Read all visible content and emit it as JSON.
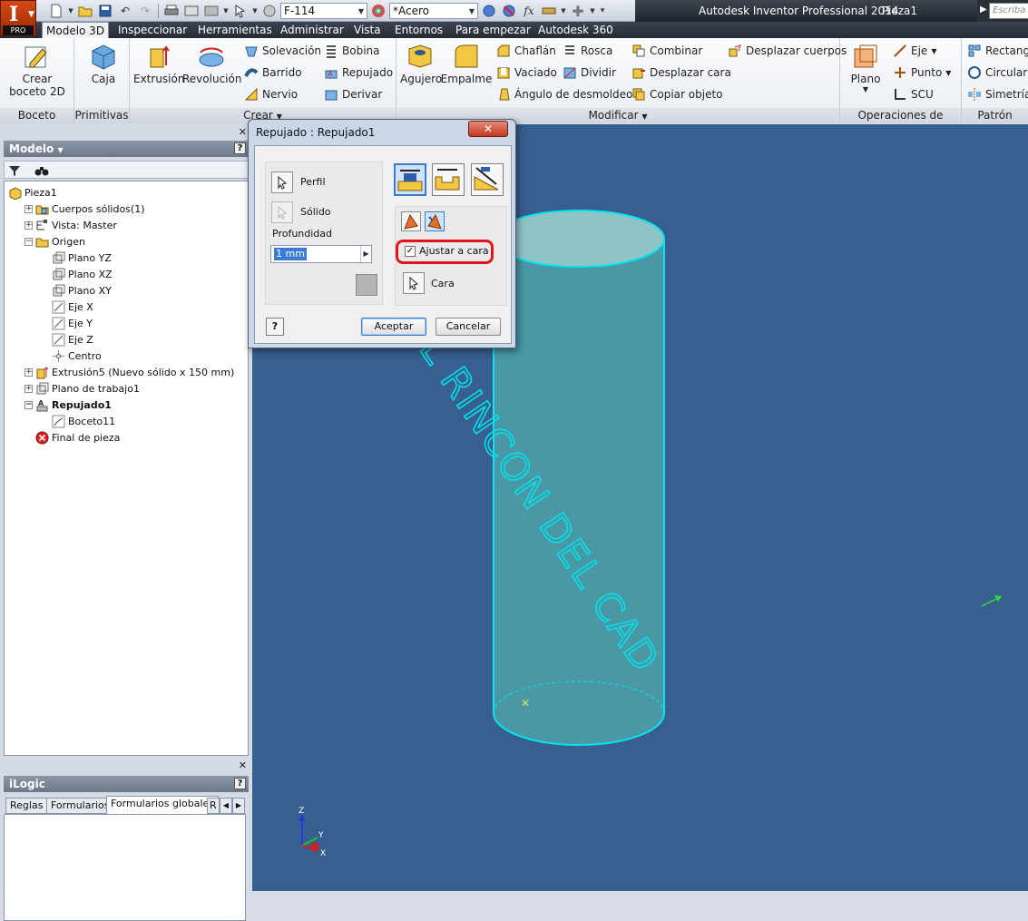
{
  "app": {
    "title": "Autodesk Inventor Professional 2014",
    "document": "Pieza1",
    "logo_letter": "I",
    "logo_edition": "PRO",
    "search_placeholder": "Escriba p"
  },
  "quick_access": {
    "style_value": "F-114",
    "material_value": "*Acero",
    "fx_label": "fx"
  },
  "tabs": [
    "Modelo 3D",
    "Inspeccionar",
    "Herramientas",
    "Administrar",
    "Vista",
    "Entornos",
    "Para empezar",
    "Autodesk 360"
  ],
  "ribbon": {
    "boceto": {
      "label": "Boceto",
      "create_line1": "Crear",
      "create_line2": "boceto 2D"
    },
    "primitivas": {
      "label": "Primitivas",
      "caja": "Caja"
    },
    "crear": {
      "label": "Crear",
      "extrusion": "Extrusión",
      "revolucion": "Revolución",
      "solevacion": "Solevación",
      "barrido": "Barrido",
      "nervio": "Nervio",
      "bobina": "Bobina",
      "repujado": "Repujado",
      "derivar": "Derivar"
    },
    "modificar": {
      "label": "Modificar",
      "agujero": "Agujero",
      "empalme": "Empalme",
      "chaflan": "Chaflán",
      "vaciado": "Vaciado",
      "angulo": "Ángulo de desmoldeo",
      "rosca": "Rosca",
      "dividir": "Dividir",
      "combinar": "Combinar",
      "desplazar_cara": "Desplazar cara",
      "copiar_objeto": "Copiar objeto",
      "desplazar_cuerpos": "Desplazar cuerpos"
    },
    "operaciones": {
      "label": "Operaciones de trabajo",
      "plano": "Plano",
      "eje": "Eje",
      "punto": "Punto",
      "scu": "SCU"
    },
    "patron": {
      "label": "Patrón",
      "rectangular": "Rectangu",
      "circular": "Circular",
      "simetria": "Simetría"
    }
  },
  "browser": {
    "title": "Modelo",
    "tree": [
      {
        "label": "Pieza1",
        "level": 0,
        "expander": "",
        "icon": "part-icon",
        "bold": false
      },
      {
        "label": "Cuerpos sólidos(1)",
        "level": 1,
        "expander": "+",
        "icon": "solid-bodies-icon",
        "bold": false
      },
      {
        "label": "Vista: Master",
        "level": 1,
        "expander": "+",
        "icon": "view-icon",
        "bold": false
      },
      {
        "label": "Origen",
        "level": 1,
        "expander": "−",
        "icon": "folder-icon",
        "bold": false
      },
      {
        "label": "Plano YZ",
        "level": 2,
        "expander": "",
        "icon": "plane-icon",
        "bold": false
      },
      {
        "label": "Plano XZ",
        "level": 2,
        "expander": "",
        "icon": "plane-icon",
        "bold": false
      },
      {
        "label": "Plano XY",
        "level": 2,
        "expander": "",
        "icon": "plane-icon",
        "bold": false
      },
      {
        "label": "Eje X",
        "level": 2,
        "expander": "",
        "icon": "axis-icon",
        "bold": false
      },
      {
        "label": "Eje Y",
        "level": 2,
        "expander": "",
        "icon": "axis-icon",
        "bold": false
      },
      {
        "label": "Eje Z",
        "level": 2,
        "expander": "",
        "icon": "axis-icon",
        "bold": false
      },
      {
        "label": "Centro",
        "level": 2,
        "expander": "",
        "icon": "point-icon",
        "bold": false
      },
      {
        "label": "Extrusión5 (Nuevo sólido x 150 mm)",
        "level": 1,
        "expander": "+",
        "icon": "extrusion-icon",
        "bold": false
      },
      {
        "label": "Plano de trabajo1",
        "level": 1,
        "expander": "+",
        "icon": "plane-icon",
        "bold": false
      },
      {
        "label": "Repujado1",
        "level": 1,
        "expander": "−",
        "icon": "emboss-icon",
        "bold": true
      },
      {
        "label": "Boceto11",
        "level": 2,
        "expander": "",
        "icon": "sketch-icon",
        "bold": false
      },
      {
        "label": "Final de pieza",
        "level": 1,
        "expander": "",
        "icon": "end-of-part-icon",
        "bold": false
      }
    ]
  },
  "ilogic": {
    "title": "iLogic",
    "tabs": [
      "Reglas",
      "Formularios",
      "Formularios globales",
      "R"
    ]
  },
  "dialog": {
    "title": "Repujado : Repujado1",
    "close": "✕",
    "perfil": "Perfil",
    "solido": "Sólido",
    "profundidad": "Profundidad",
    "depth_value": "1 mm",
    "ajustar_a_cara": "Ajustar a cara",
    "ajustar_checked": true,
    "cara": "Cara",
    "help": "?",
    "aceptar": "Aceptar",
    "cancelar": "Cancelar"
  },
  "viewport": {
    "emboss_text": "COMUNIDAD EL RINCON DEL CAD",
    "triad": {
      "z": "Z",
      "y": "Y",
      "x": "X"
    },
    "colors": {
      "background": "#375f8f",
      "cylinder": "#4ea1a9",
      "edge": "#00e5ee",
      "text": "#00e0e8"
    }
  }
}
